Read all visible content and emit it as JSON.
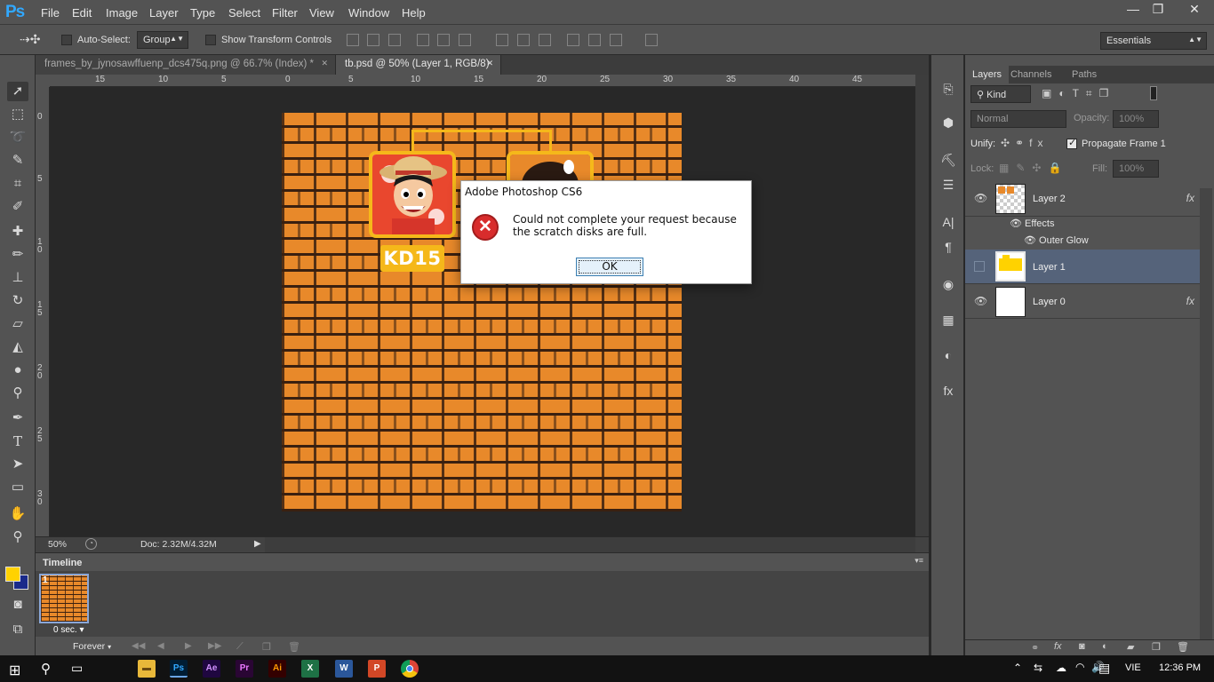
{
  "app": {
    "logo": "Ps"
  },
  "menu": [
    "File",
    "Edit",
    "Image",
    "Layer",
    "Type",
    "Select",
    "Filter",
    "View",
    "Window",
    "Help"
  ],
  "window_controls": [
    "—",
    "❐",
    "✕"
  ],
  "options": {
    "auto_select_label": "Auto-Select:",
    "auto_select_value": "Group",
    "transform_label": "Show Transform Controls",
    "workspace_value": "Essentials"
  },
  "tabs": [
    {
      "label": "frames_by_jynosawffuenp_dcs475q.png @ 66.7% (Index) *",
      "close": "✕"
    },
    {
      "label": "tb.psd @ 50% (Layer 1, RGB/8)",
      "close": "✕"
    }
  ],
  "ruler_top": [
    "15",
    "10",
    "5",
    "0",
    "5",
    "10",
    "15",
    "20",
    "25",
    "30",
    "35",
    "40",
    "45"
  ],
  "ruler_left": [
    "0",
    "5",
    "1 0",
    "1 5",
    "2 0",
    "2 5",
    "3 0"
  ],
  "canvas": {
    "badge_text": "KD15"
  },
  "dialog": {
    "title": "Adobe Photoshop CS6",
    "icon": "✕",
    "message": "Could not complete your request because the scratch disks are full.",
    "ok_label": "OK"
  },
  "status": {
    "zoom": "50%",
    "doc": "Doc: 2.32M/4.32M"
  },
  "timeline": {
    "tab_label": "Timeline",
    "frame_number": "1",
    "frame_delay": "0 sec.",
    "loop": "Forever"
  },
  "layers_panel": {
    "tabs": [
      "Layers",
      "Channels",
      "Paths"
    ],
    "filter_kind": "Kind",
    "blend_mode": "Normal",
    "opacity_label": "Opacity:",
    "opacity_value": "100%",
    "unify_label": "Unify:",
    "propagate_label": "Propagate Frame 1",
    "lock_label": "Lock:",
    "fill_label": "Fill:",
    "fill_value": "100%",
    "effects_label": "Effects",
    "outer_glow_label": "Outer Glow",
    "layers": [
      {
        "name": "Layer 2",
        "fx": "fx"
      },
      {
        "name": "Layer 1",
        "fx": ""
      },
      {
        "name": "Layer 0",
        "fx": "fx"
      }
    ]
  },
  "taskbar": {
    "lang": "VIE",
    "time": "12:36 PM",
    "apps": [
      "Ps",
      "Ae",
      "Pr",
      "Ai",
      "X",
      "W",
      "P"
    ]
  },
  "colors": {
    "accent": "#31a8ff",
    "brick": "#e8892a",
    "frame": "#f5b81a",
    "error": "#d82c2c",
    "foreground": "#ffd200",
    "background": "#1a2a8a"
  }
}
